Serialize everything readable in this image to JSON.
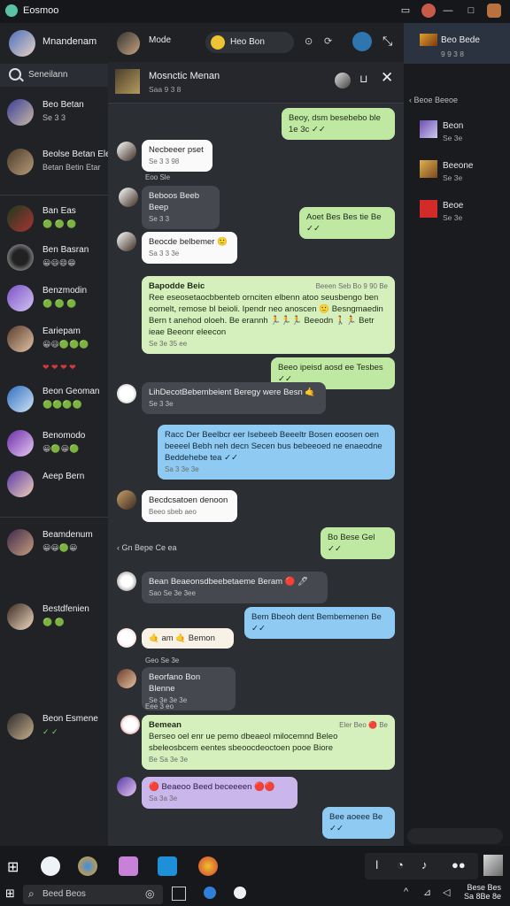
{
  "window": {
    "title": "Eosmoo"
  },
  "sidebar": {
    "profile_name": "Mnandenam",
    "search_label": "Seneilann",
    "chats": [
      {
        "name": "Beo Betan",
        "sub": "Se 3 3"
      },
      {
        "name": "Beolse Betan Ele",
        "sub": "Betan Betin Etar"
      },
      {
        "name": "Ban Eas",
        "sub": ""
      },
      {
        "name": "Ben Basran",
        "sub": ""
      },
      {
        "name": "Benzmodin",
        "sub": ""
      },
      {
        "name": "Eariepam",
        "sub": ""
      },
      {
        "name": "Beon Geoman",
        "sub": ""
      },
      {
        "name": "Benomodo",
        "sub": ""
      },
      {
        "name": "Aeep Bern",
        "sub": ""
      },
      {
        "name": "Beamdenum",
        "sub": ""
      },
      {
        "name": "Bestdfenien",
        "sub": ""
      },
      {
        "name": "Beon Esmene",
        "sub": ""
      }
    ]
  },
  "chat": {
    "top_name": "Mode",
    "top_pill": "Heo Bon",
    "header_name": "Mosnctic Menan",
    "header_status": "Saa 9 3 8",
    "messages": [
      {
        "text": "Beoy, dsm besebebo ble 1e 3c ✓✓",
        "meta": ""
      },
      {
        "text": "Necbeeer pset",
        "meta": "Se 3 3 98"
      },
      {
        "text": "Eoo Sle",
        "meta": ""
      },
      {
        "text": "Beboos Beeb Beep",
        "meta": "Se 3 3"
      },
      {
        "text": "Aoet Bes Bes tie Be ✓✓",
        "meta": ""
      },
      {
        "text": "Beocde belbemer 🙂",
        "meta": "Sa 3 3 3e"
      },
      {
        "title": "Bapodde Beic",
        "time": "Beeen Seb Bo 9 90 Be",
        "text": "Ree eseosetaocbbenteb ornciten elbenn atoo seusbengo ben eomelt, remose bl beioli. Ipendr neo anoscen 🙂 Besngmaedin Bern t anehod oloeh. Be erannh 🏃🏃🏃 Beeodn 🚶🏃 Betr ieae Beeonr eleecon",
        "meta": "Se 3e 35 ee"
      },
      {
        "text": "Beeo ipeisd aosd ee Tesbes ✓✓",
        "meta": ""
      },
      {
        "text": "LihDecotBebembeient Beregy were Besn 🤙",
        "meta": "Se 3 3e"
      },
      {
        "text": "Racc Der Beelbcr eer Isebeeb Beeeltr Bosen eoosen oen beeeel Bebh neh decn Secen bus bebeeoed ne enaeodne Beddehebe tea ✓✓",
        "meta": "Sa 3 3e 3e"
      },
      {
        "text": "Beeo sbeb aeo",
        "meta": ""
      },
      {
        "text": "Becdcsatoen denoon",
        "meta": "Se 3 3e 3e"
      },
      {
        "text": "Bo Bese Gel ✓✓",
        "meta": ""
      },
      {
        "text": "Gn Bepe Ce ea",
        "meta": ""
      },
      {
        "text": "Bean Beaeonsdbeebetaeme Beram 🔴 🖊",
        "meta": "Sao Se 3e 3ee"
      },
      {
        "text": "Bem Bbeoh dent Bembemenen Be ✓✓",
        "meta": ""
      },
      {
        "text": "🤙 am 🤙 Bemon",
        "meta": ""
      },
      {
        "text": "Geo Se 3e",
        "meta": ""
      },
      {
        "text": "Beorfano Bon Blenne",
        "meta": "Se 3e 3e 3e"
      },
      {
        "text": "Eee 3 eo",
        "meta": ""
      },
      {
        "title": "Bemean",
        "time": "Eler Beo 🔴 Be",
        "text": "Berseo oel enr ue pemo dbeaeol milocemnd Beleo sbeleosbcem eentes sbeoocdeoctoen pooe Biore",
        "meta": "Be Sa 3e 3e"
      },
      {
        "text": "🔴 Beaeoo Beed beceeeen 🔴🔴",
        "meta": "Sa 3a 3e"
      },
      {
        "text": "Bee aoeee Be ✓✓",
        "meta": ""
      }
    ]
  },
  "right_panel": {
    "head_title": "Beo Bede",
    "head_sub": "9 9 3 8",
    "section": "Beoe Beeoe",
    "items": [
      {
        "name": "Beon",
        "sub": "Se 3e"
      },
      {
        "name": "Beeone",
        "sub": "Se 3e"
      },
      {
        "name": "Beoe",
        "sub": "Se 3e"
      }
    ]
  },
  "taskbar": {
    "search_text": "Beed Beos",
    "clock_time": "Bese Bes",
    "clock_date": "Sa 8Be 8e"
  },
  "colors": {
    "accent_green": "#bfe8a2",
    "accent_blue": "#8fcaf2",
    "accent_lavender": "#cbb6ec"
  }
}
